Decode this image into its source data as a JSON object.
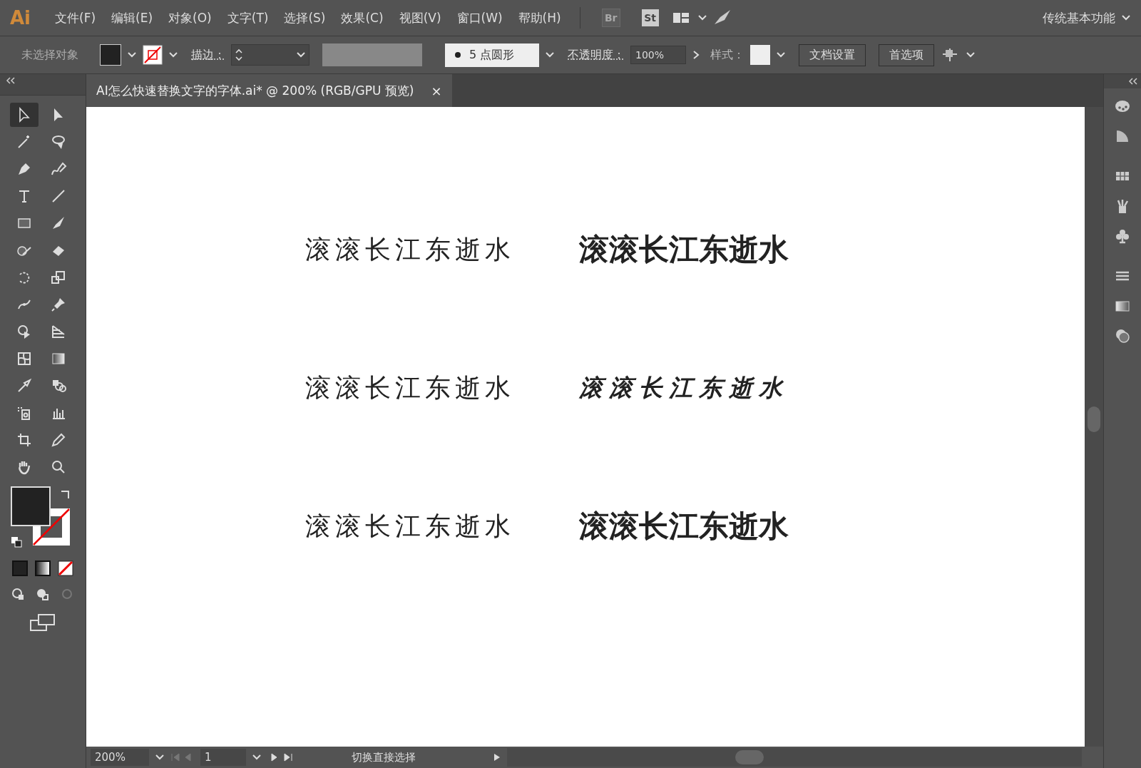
{
  "app": {
    "logo": "Ai",
    "menu": [
      "文件(F)",
      "编辑(E)",
      "对象(O)",
      "文字(T)",
      "选择(S)",
      "效果(C)",
      "视图(V)",
      "窗口(W)",
      "帮助(H)"
    ],
    "bridge": "Br",
    "stock": "St",
    "workspace": "传统基本功能"
  },
  "control_bar": {
    "selection": "未选择对象",
    "stroke_label": "描边：",
    "brush": "5 点圆形",
    "opacity_label": "不透明度：",
    "opacity": "100%",
    "style_label": "样式：",
    "buttons": [
      "文档设置",
      "首选项"
    ]
  },
  "tab": {
    "title": "AI怎么快速替换文字的字体.ai* @ 200% (RGB/GPU 预览)",
    "close": "×"
  },
  "canvas": {
    "rows": [
      {
        "left": {
          "text": "滚滚长江东逝水",
          "kind": "serif"
        },
        "right": {
          "text": "滚滚长江东逝水",
          "kind": "bold"
        }
      },
      {
        "left": {
          "text": "滚滚长江东逝水",
          "kind": "serif"
        },
        "right": {
          "text": "滚滚长江东逝水",
          "kind": "brush"
        }
      },
      {
        "left": {
          "text": "滚滚长江东逝水",
          "kind": "serif"
        },
        "right": {
          "text": "滚滚长江东逝水",
          "kind": "bold"
        }
      }
    ]
  },
  "status_bar": {
    "zoom": "200%",
    "page": "1",
    "tool": "切换直接选择"
  }
}
